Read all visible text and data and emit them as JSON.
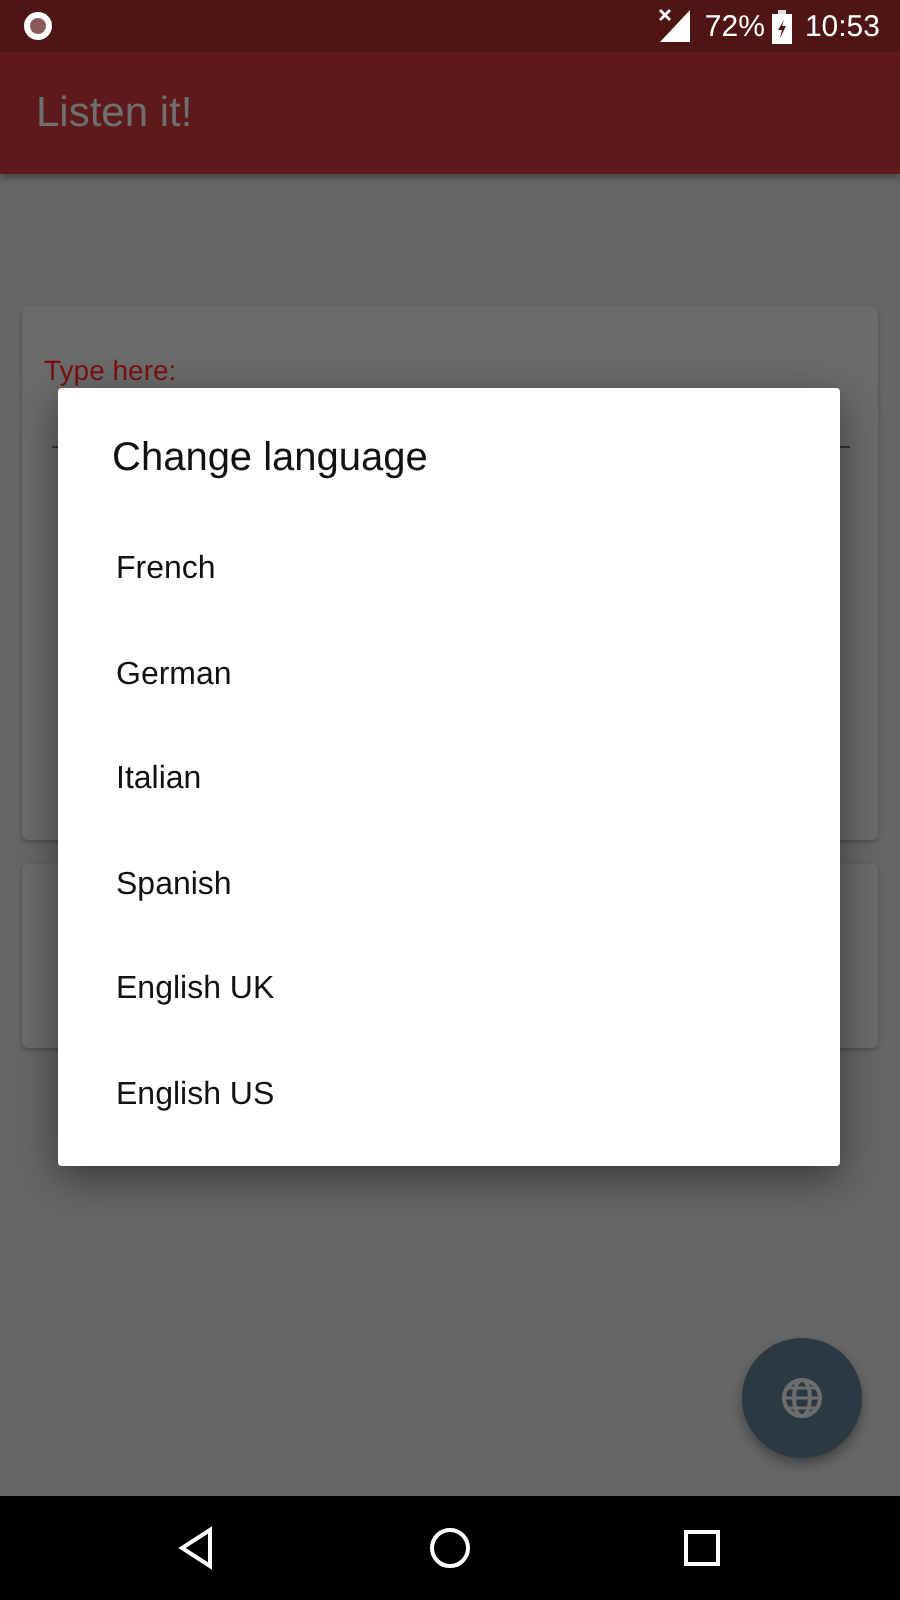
{
  "status_bar": {
    "battery": "72%",
    "time": "10:53"
  },
  "app_bar": {
    "title": "Listen it!"
  },
  "background_card": {
    "label": "Type here:"
  },
  "dialog": {
    "title": "Change language",
    "options": [
      {
        "label": "French"
      },
      {
        "label": "German"
      },
      {
        "label": "Italian"
      },
      {
        "label": "Spanish"
      },
      {
        "label": "English UK"
      },
      {
        "label": "English US"
      }
    ]
  }
}
